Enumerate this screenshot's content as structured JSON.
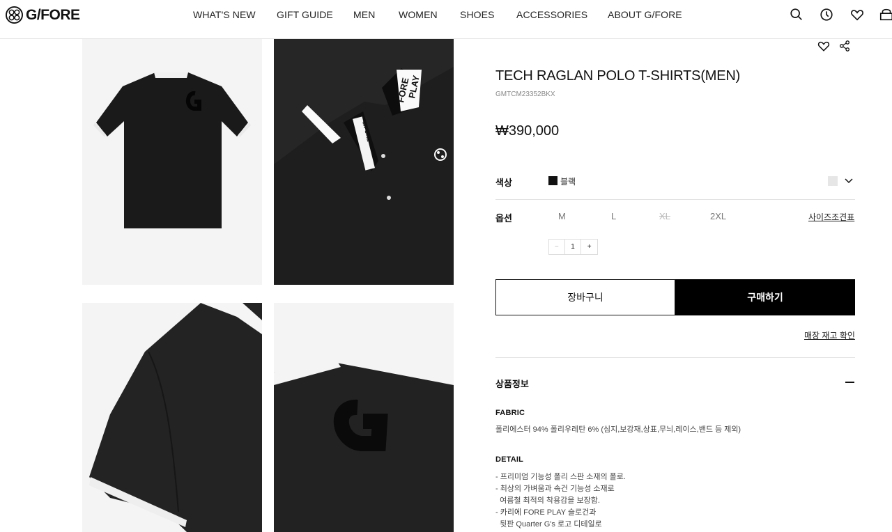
{
  "header": {
    "logo_text": "G/FORE",
    "nav": [
      "WHAT'S NEW",
      "GIFT GUIDE",
      "MEN",
      "WOMEN",
      "SHOES",
      "ACCESSORIES",
      "ABOUT G/FORE"
    ],
    "icons": [
      "search-icon",
      "recent-history-icon",
      "wishlist-heart-icon",
      "cart-bag-icon"
    ]
  },
  "gallery": {
    "images": [
      {
        "name": "product-image-back"
      },
      {
        "name": "product-image-collar-front"
      },
      {
        "name": "product-image-sleeve"
      },
      {
        "name": "product-image-back-detail"
      }
    ],
    "print_texts": [
      "FORE",
      "PLAY",
      "G/FORE"
    ]
  },
  "product": {
    "title": "TECH RAGLAN POLO T-SHIRTS(MEN)",
    "sku": "GMTCM23352BKX",
    "price": "₩390,000",
    "color_label": "색상",
    "color_value": "블랙",
    "color_hex": "#111111",
    "option_label": "옵션",
    "sizes": [
      {
        "label": "M",
        "sold_out": false
      },
      {
        "label": "L",
        "sold_out": false
      },
      {
        "label": "XL",
        "sold_out": true
      },
      {
        "label": "2XL",
        "sold_out": false
      }
    ],
    "size_chart_link": "사이즈조견표",
    "qty": {
      "minus": "−",
      "value": "1",
      "plus": "+"
    },
    "cart_button": "장바구니",
    "buy_button": "구매하기",
    "stock_link": "매장 재고 확인"
  },
  "info": {
    "title": "상품정보",
    "fabric_head": "FABRIC",
    "fabric_text": "폴리에스터 94% 폴리우레탄 6% (심지,보강재,상표,무늬,레이스,밴드 등 제외)",
    "detail_head": "DETAIL",
    "detail_lines": [
      "- 프리미엄 기능성 폴리 스판 소재의 폴로.",
      "- 최상의 가벼움과 속건 기능성 소재로",
      "  여름철 최적의 착용감을 보장함.",
      "- 카리에 FORE PLAY 슬로건과",
      "  뒷판 Quarter G's 로고 디테일로"
    ]
  }
}
